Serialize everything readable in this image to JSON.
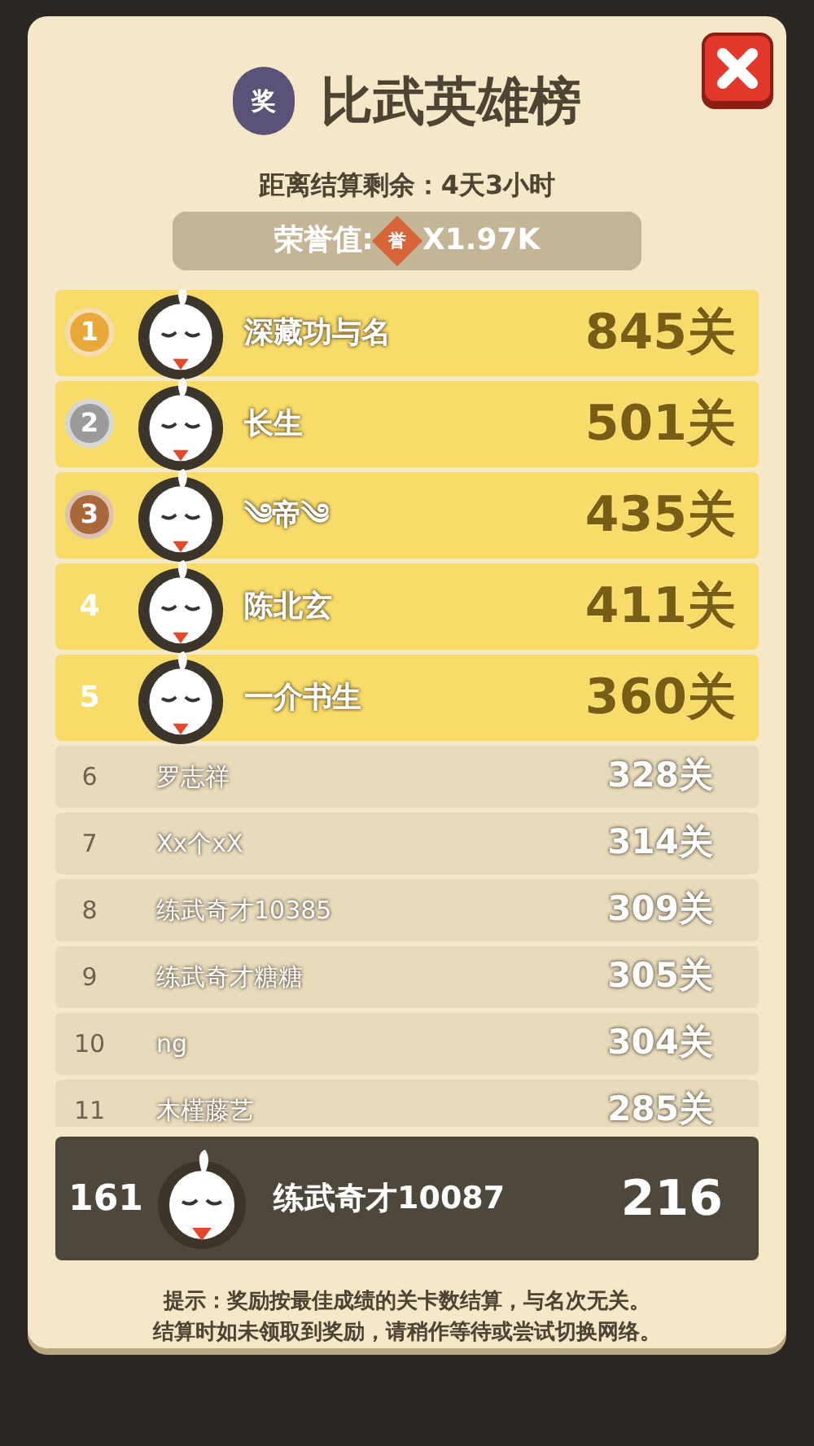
{
  "dialog": {
    "badge": "奖",
    "title": "比武英雄榜",
    "countdown": "距离结算剩余：4天3小时",
    "honor_label": "荣誉值:",
    "honor_icon": "誉",
    "honor_value": "X1.97K"
  },
  "rows": [
    {
      "kind": "medal",
      "color": "#e8a93a",
      "rank": "1",
      "name": "深藏功与名",
      "score": "845关"
    },
    {
      "kind": "medal",
      "color": "#9a9a9a",
      "rank": "2",
      "name": "长生",
      "score": "501关"
    },
    {
      "kind": "medal",
      "color": "#a8683c",
      "rank": "3",
      "name": "༄帝༄",
      "score": "435关"
    },
    {
      "kind": "top",
      "rank": "4",
      "name": "陈北玄",
      "score": "411关"
    },
    {
      "kind": "top",
      "rank": "5",
      "name": "一介书生",
      "score": "360关"
    },
    {
      "kind": "plain",
      "rank": "6",
      "name": "罗志祥",
      "score": "328关"
    },
    {
      "kind": "plain",
      "rank": "7",
      "name": "Xx个xX",
      "score": "314关"
    },
    {
      "kind": "plain",
      "rank": "8",
      "name": "练武奇才10385",
      "score": "309关"
    },
    {
      "kind": "plain",
      "rank": "9",
      "name": "练武奇才糖糖",
      "score": "305关"
    },
    {
      "kind": "plain",
      "rank": "10",
      "name": "ng",
      "score": "304关"
    },
    {
      "kind": "plain",
      "rank": "11",
      "name": "木槿藤艺",
      "score": "285关"
    }
  ],
  "me": {
    "rank": "161",
    "name": "练武奇才10087",
    "score": "216"
  },
  "tips": [
    "提示：奖励按最佳成绩的关卡数结算，与名次无关。",
    "结算时如未领取到奖励，请稍作等待或尝试切换网络。"
  ]
}
